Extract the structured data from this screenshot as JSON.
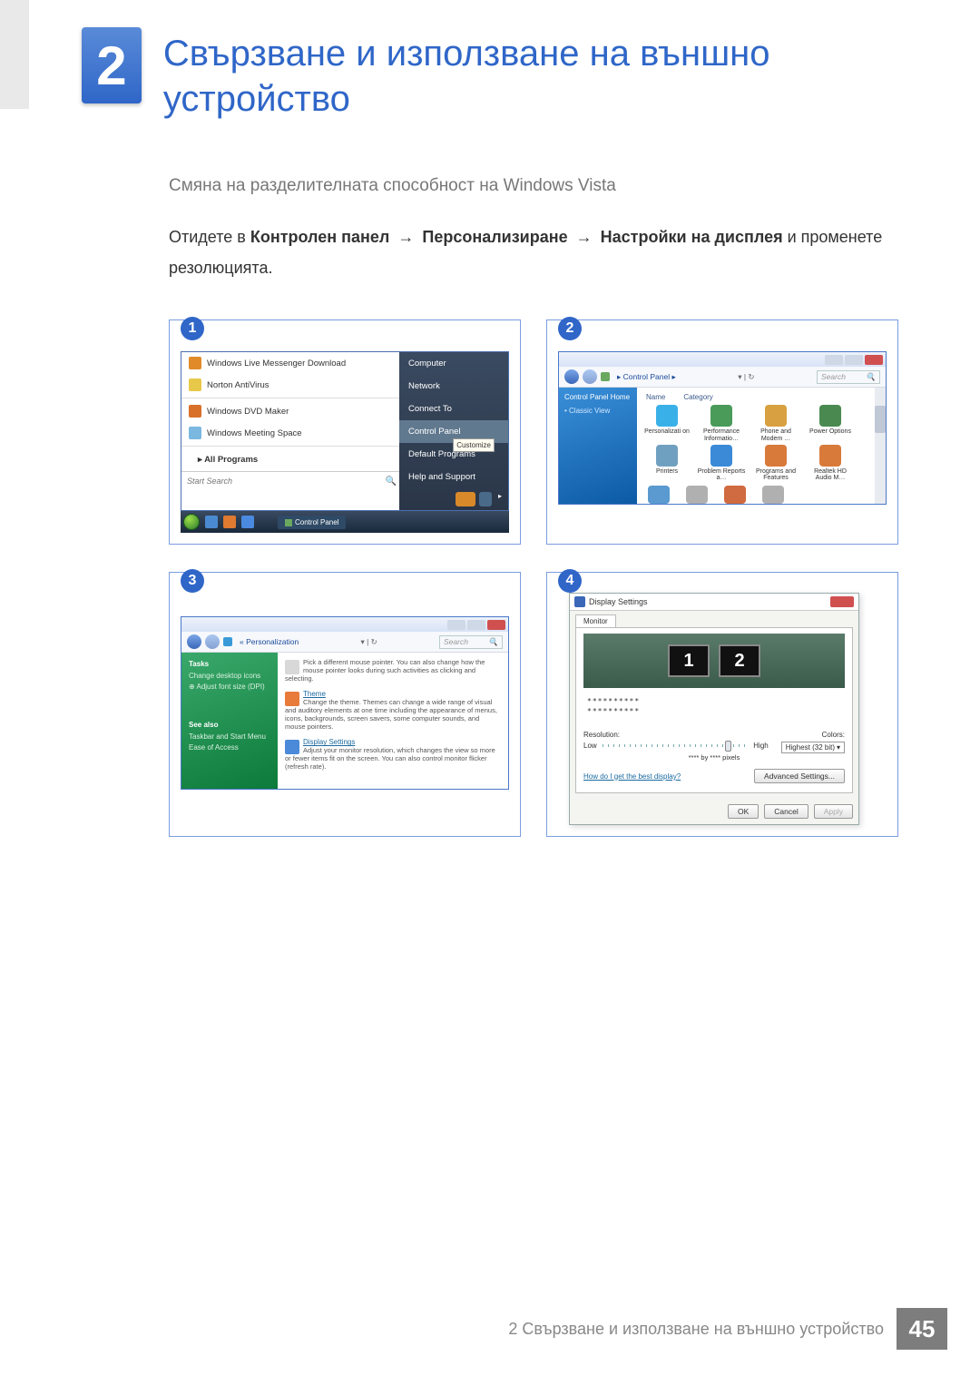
{
  "chapter": {
    "number": "2",
    "title": "Свързване и използване на външно устройство"
  },
  "subheading": "Смяна на разделителната способност на Windows Vista",
  "body": {
    "prefix": "Отидете в ",
    "b1": "Контролен панел",
    "b2": "Персонализиране",
    "b3": "Настройки на дисплея",
    "suffix": " и променете резолюцията.",
    "arrow": "→"
  },
  "step": {
    "n1": "1",
    "n2": "2",
    "n3": "3",
    "n4": "4"
  },
  "start_menu": {
    "items": [
      {
        "label": "Windows Live Messenger Download"
      },
      {
        "label": "Norton AntiVirus"
      },
      {
        "label": "Windows DVD Maker"
      },
      {
        "label": "Windows Meeting Space"
      }
    ],
    "all_programs": "All Programs",
    "search_placeholder": "Start Search",
    "right": {
      "computer": "Computer",
      "network": "Network",
      "connect": "Connect To",
      "control_panel": "Control Panel",
      "defaults": "Default Programs",
      "help": "Help and Support"
    },
    "tooltip": "Customize",
    "taskbar_task": "Control Panel"
  },
  "control_panel": {
    "crumb": "▸ Control Panel ▸",
    "search": "Search",
    "side_home": "Control Panel Home",
    "side_classic": "Classic View",
    "col_name": "Name",
    "col_cat": "Category",
    "icons": [
      "Personalizati on",
      "Performance Informatio…",
      "Phone and Modem …",
      "Power Options",
      "Printers",
      "Problem Reports a…",
      "Programs and Features",
      "Realtek HD Audio M…"
    ]
  },
  "personalization": {
    "crumb": "« Personalization",
    "search": "Search",
    "side": {
      "tasks": "Tasks",
      "change_icons": "Change desktop icons",
      "adjust_font": "Adjust font size (DPI)",
      "see_also": "See also",
      "taskbar": "Taskbar and Start Menu",
      "ease": "Ease of Access"
    },
    "mouse": {
      "d": "Pick a different mouse pointer. You can also change how the mouse pointer looks during such activities as clicking and selecting."
    },
    "theme": {
      "t": "Theme",
      "d": "Change the theme. Themes can change a wide range of visual and auditory elements at one time including the appearance of menus, icons, backgrounds, screen savers, some computer sounds, and mouse pointers."
    },
    "display": {
      "t": "Display Settings",
      "d": "Adjust your monitor resolution, which changes the view so more or fewer items fit on the screen. You can also control monitor flicker (refresh rate)."
    }
  },
  "display_settings": {
    "title": "Display Settings",
    "tab": "Monitor",
    "mon1": "1",
    "mon2": "2",
    "stars": "**********",
    "resolution": "Resolution:",
    "colors": "Colors:",
    "low": "Low",
    "high": "High",
    "bypx": "**** by **** pixels",
    "color_sel": "Highest (32 bit)",
    "link": "How do I get the best display?",
    "adv": "Advanced Settings...",
    "ok": "OK",
    "cancel": "Cancel",
    "apply": "Apply"
  },
  "footer": {
    "text": "2 Свързване и използване на външно устройство",
    "page": "45"
  }
}
